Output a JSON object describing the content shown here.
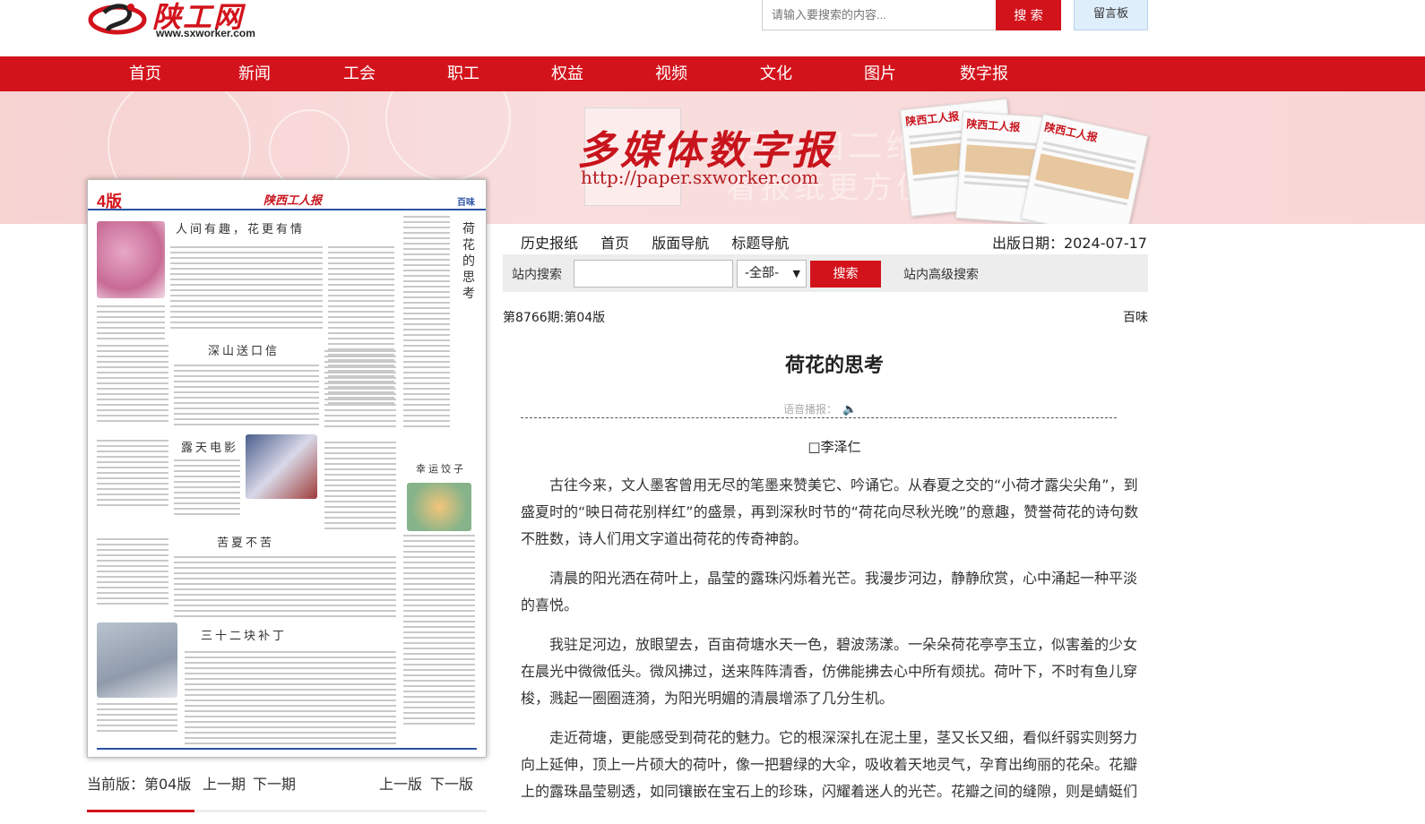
{
  "header": {
    "logo_text": "陕工网",
    "logo_url": "www.sxworker.com",
    "search_placeholder": "请输入要搜索的内容...",
    "search_button": "搜 索",
    "message_board": "留言板"
  },
  "nav": {
    "items": [
      {
        "label": "首页"
      },
      {
        "label": "新闻"
      },
      {
        "label": "工会"
      },
      {
        "label": "职工"
      },
      {
        "label": "权益"
      },
      {
        "label": "视频"
      },
      {
        "label": "文化"
      },
      {
        "label": "图片"
      },
      {
        "label": "数字报"
      }
    ]
  },
  "banner": {
    "title": "多媒体数字报",
    "url": "http://paper.sxworker.com",
    "ghost_text_1": "扫一扫二维",
    "ghost_text_2": "看报纸更方便",
    "paper_name": "陕西工人报"
  },
  "paper_page": {
    "page_num": "4版",
    "paper_name": "陕西工人报",
    "section": "百味",
    "vertical_title": "荷花的思考",
    "headings": [
      "人间有趣，花更有情",
      "深山送口信",
      "露天电影",
      "幸运饺子",
      "苦夏不苦",
      "三十二块补丁"
    ]
  },
  "pager": {
    "current_label": "当前版：第04版",
    "prev_issue": "上一期",
    "next_issue": "下一期",
    "prev_page": "上一版",
    "next_page": "下一版"
  },
  "article_nav": {
    "items": [
      "历史报纸",
      "首页",
      "版面导航",
      "标题导航"
    ],
    "pub_date": "出版日期：2024-07-17"
  },
  "site_search": {
    "label": "站内搜索",
    "select_value": "-全部-",
    "button": "搜索",
    "advanced": "站内高级搜索"
  },
  "article": {
    "issue": "第8766期:第04版",
    "column": "百味",
    "title": "荷花的思考",
    "voice_label": "语音播报：",
    "author": "□李泽仁",
    "paragraphs": [
      "古往今来，文人墨客曾用无尽的笔墨来赞美它、吟诵它。从春夏之交的“小荷才露尖尖角”，到盛夏时的“映日荷花别样红”的盛景，再到深秋时节的“荷花向尽秋光晚”的意趣，赞誉荷花的诗句数不胜数，诗人们用文字道出荷花的传奇神韵。",
      "清晨的阳光洒在荷叶上，晶莹的露珠闪烁着光芒。我漫步河边，静静欣赏，心中涌起一种平淡的喜悦。",
      "我驻足河边，放眼望去，百亩荷塘水天一色，碧波荡漾。一朵朵荷花亭亭玉立，似害羞的少女在晨光中微微低头。微风拂过，送来阵阵清香，仿佛能拂去心中所有烦扰。荷叶下，不时有鱼儿穿梭，溅起一圈圈涟漪，为阳光明媚的清晨增添了几分生机。",
      "走近荷塘，更能感受到荷花的魅力。它的根深深扎在泥土里，茎又长又细，看似纤弱实则努力向上延伸，顶上一片硕大的荷叶，像一把碧绿的大伞，吸收着天地灵气，孕育出绚丽的花朵。花瓣上的露珠晶莹剔透，如同镶嵌在宝石上的珍珠，闪耀着迷人的光芒。花瓣之间的缝隙，则是蜻蜓们"
    ]
  },
  "colors": {
    "brand_red": "#d3131c",
    "banner_pink": "#f6d2d1",
    "paper_blue": "#2a52a3"
  }
}
